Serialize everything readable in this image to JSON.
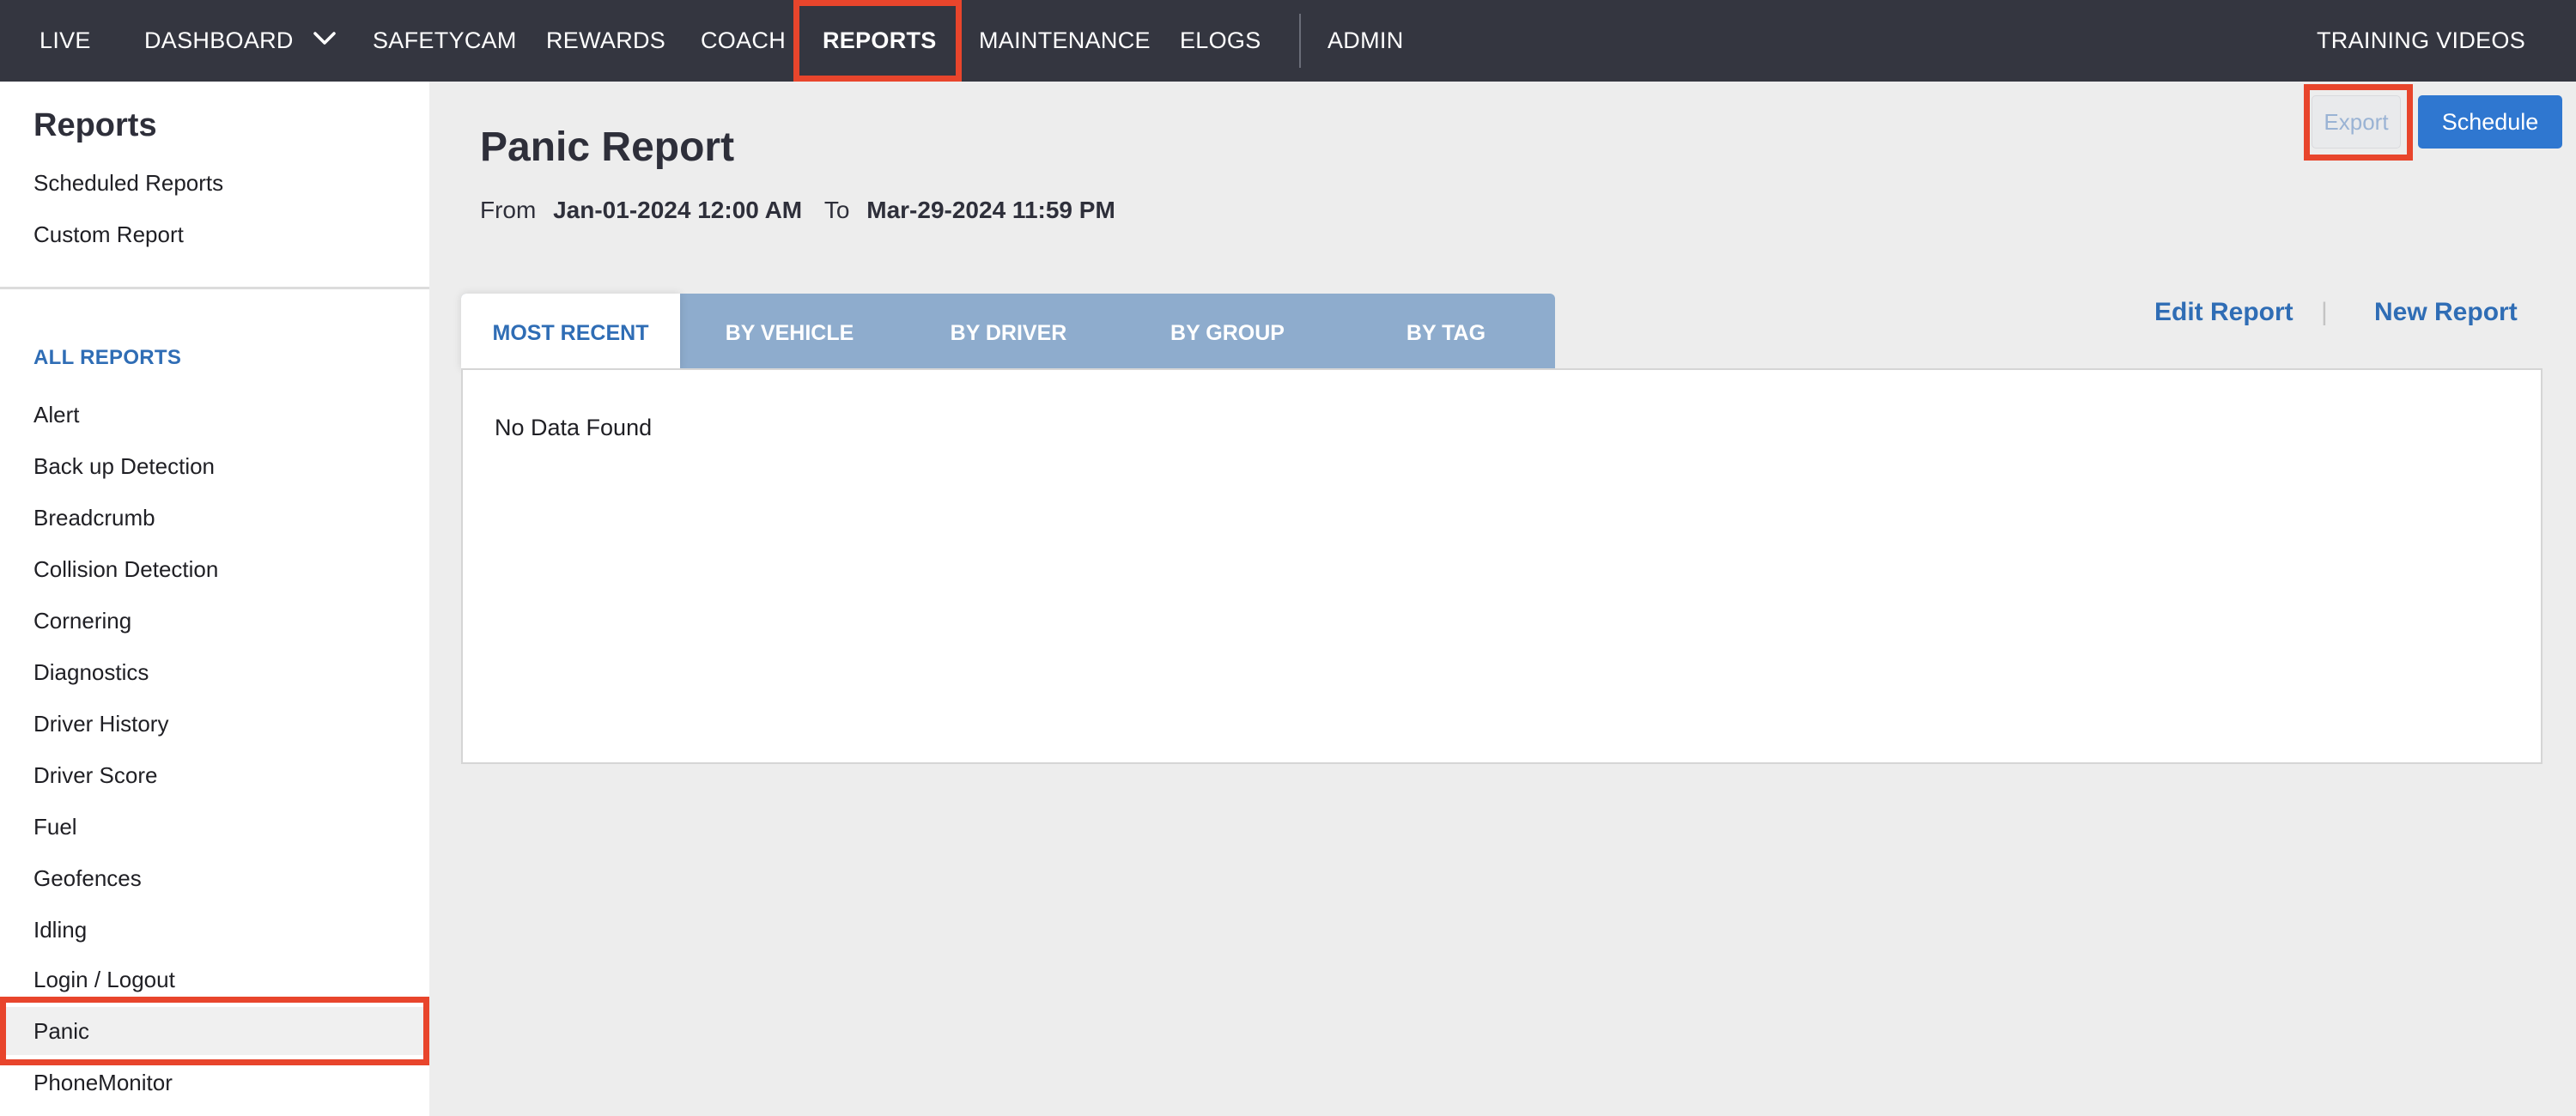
{
  "topnav": {
    "items": [
      {
        "label": "LIVE"
      },
      {
        "label": "DASHBOARD"
      },
      {
        "label": "SAFETYCAM"
      },
      {
        "label": "REWARDS"
      },
      {
        "label": "COACH"
      },
      {
        "label": "REPORTS",
        "active": true
      },
      {
        "label": "MAINTENANCE"
      },
      {
        "label": "ELOGS"
      },
      {
        "label": "ADMIN"
      }
    ],
    "training_videos": "TRAINING VIDEOS"
  },
  "sidebar": {
    "title": "Reports",
    "links": [
      {
        "label": "Scheduled Reports"
      },
      {
        "label": "Custom Report"
      }
    ],
    "section_label": "ALL REPORTS",
    "reports": [
      {
        "label": "Alert"
      },
      {
        "label": "Back up Detection"
      },
      {
        "label": "Breadcrumb"
      },
      {
        "label": "Collision Detection"
      },
      {
        "label": "Cornering"
      },
      {
        "label": "Diagnostics"
      },
      {
        "label": "Driver History"
      },
      {
        "label": "Driver Score"
      },
      {
        "label": "Fuel"
      },
      {
        "label": "Geofences"
      },
      {
        "label": "Idling"
      },
      {
        "label": "Login / Logout"
      },
      {
        "label": "Panic",
        "selected": true
      },
      {
        "label": "PhoneMonitor"
      }
    ]
  },
  "main": {
    "title": "Panic Report",
    "from_label": "From",
    "from_value": "Jan-01-2024 12:00 AM",
    "to_label": "To",
    "to_value": "Mar-29-2024 11:59 PM",
    "export_label": "Export",
    "schedule_label": "Schedule",
    "edit_report_label": "Edit Report",
    "separator": "|",
    "new_report_label": "New Report",
    "tabs": [
      {
        "label": "MOST RECENT",
        "active": true
      },
      {
        "label": "BY VEHICLE"
      },
      {
        "label": "BY DRIVER"
      },
      {
        "label": "BY GROUP"
      },
      {
        "label": "BY TAG"
      }
    ],
    "empty_message": "No Data Found"
  },
  "colors": {
    "nav_bg": "#343640",
    "accent_blue": "#2f6db5",
    "button_blue": "#2f77d0",
    "tab_bar": "#8eaccd",
    "highlight_red": "#e8452c",
    "page_bg": "#ededed"
  },
  "icons": {
    "dashboard_dropdown": "chevron-down-icon"
  }
}
